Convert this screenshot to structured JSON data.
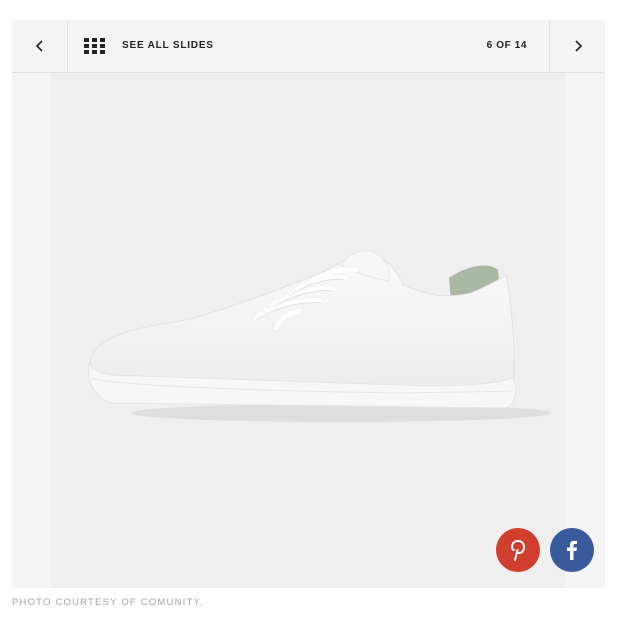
{
  "slideshow": {
    "prev_label": "‹",
    "next_label": "›",
    "see_all_label": "SEE ALL SLIDES",
    "counter": "6 OF 14",
    "current_slide": 6,
    "total_slides": 14
  },
  "image": {
    "subject": "white low-top sneaker"
  },
  "share": {
    "pinterest_icon": "pinterest-icon",
    "facebook_icon": "facebook-icon",
    "pinterest_color": "#d13d2e",
    "facebook_color": "#3a5a9c"
  },
  "caption": "PHOTO COURTESY OF COMUNITY."
}
